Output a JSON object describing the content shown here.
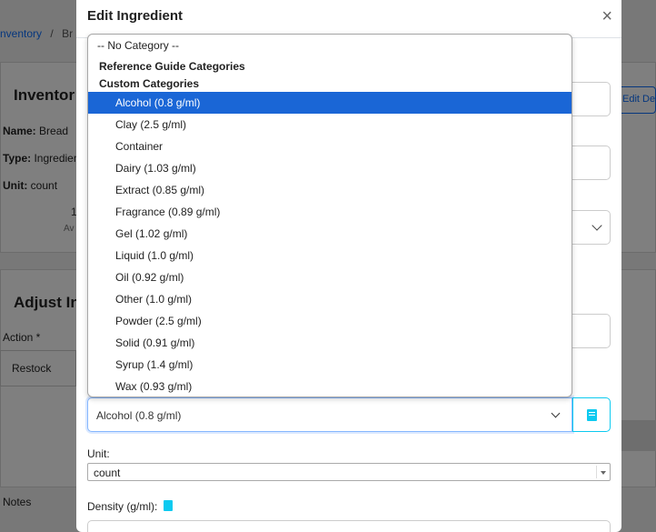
{
  "background": {
    "breadcrumb": {
      "link": "nventory",
      "sep": "/",
      "current": "Br"
    },
    "inventory_card_title": "Inventor",
    "fields": {
      "name": {
        "label": "Name:",
        "value": "Bread"
      },
      "type": {
        "label": "Type:",
        "value": "Ingredien"
      },
      "unit": {
        "label": "Unit:",
        "value": "count"
      }
    },
    "stat_value": "1",
    "stat_label": "Av",
    "edit_button": "Edit Det",
    "adjust_card_title": "Adjust Inv",
    "action_label": "Action *",
    "action_value": "Restock",
    "notes_label": "Notes"
  },
  "modal": {
    "title": "Edit Ingredient",
    "close_symbol": "×",
    "category": {
      "selected_value": "Alcohol (0.8 g/ml)",
      "dropdown": {
        "no_category": "-- No Category --",
        "groups": [
          {
            "label": "Reference Guide Categories"
          },
          {
            "label": "Custom Categories"
          }
        ],
        "options": [
          {
            "label": "Alcohol (0.8 g/ml)",
            "selected": true
          },
          {
            "label": "Clay (2.5 g/ml)"
          },
          {
            "label": "Container"
          },
          {
            "label": "Dairy (1.03 g/ml)"
          },
          {
            "label": "Extract (0.85 g/ml)"
          },
          {
            "label": "Fragrance (0.89 g/ml)"
          },
          {
            "label": "Gel (1.02 g/ml)"
          },
          {
            "label": "Liquid (1.0 g/ml)"
          },
          {
            "label": "Oil (0.92 g/ml)"
          },
          {
            "label": "Other (1.0 g/ml)"
          },
          {
            "label": "Powder (2.5 g/ml)"
          },
          {
            "label": "Solid (0.91 g/ml)"
          },
          {
            "label": "Syrup (1.4 g/ml)"
          },
          {
            "label": "Wax (0.93 g/ml)"
          }
        ]
      }
    },
    "unit": {
      "label": "Unit:",
      "value": "count"
    },
    "density": {
      "label": "Density (g/ml):"
    }
  },
  "colors": {
    "accent": "#1a66d6",
    "info": "#0dcaf0",
    "link": "#0d6efd"
  }
}
